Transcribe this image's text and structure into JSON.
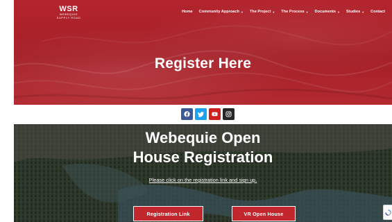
{
  "header": {
    "logo_main": "WSR",
    "logo_sub_line1": "WEBEQUIE",
    "logo_sub_line2": "SUPPLY ROAD"
  },
  "nav": {
    "items": [
      {
        "label": "Home",
        "dropdown": false
      },
      {
        "label": "Community Approach",
        "dropdown": true
      },
      {
        "label": "The Project",
        "dropdown": true
      },
      {
        "label": "The Process",
        "dropdown": true
      },
      {
        "label": "Documents",
        "dropdown": true
      },
      {
        "label": "Studies",
        "dropdown": true
      },
      {
        "label": "Contact",
        "dropdown": false
      }
    ]
  },
  "hero": {
    "title": "Register Here"
  },
  "social": {
    "icons": [
      "facebook-icon",
      "twitter-icon",
      "youtube-icon",
      "instagram-icon"
    ]
  },
  "main": {
    "title_line1": "Webequie Open",
    "title_line2": "House Registration",
    "instruction": "Please click on the registration link and sign up.",
    "registration_button": "Registration Link",
    "vr_button": "VR Open House"
  },
  "colors": {
    "hero_red": "#b3242d",
    "button_red": "#c1272d",
    "facebook": "#3b5998",
    "twitter": "#1da1f2",
    "youtube": "#cd201f",
    "instagram": "#262626"
  }
}
